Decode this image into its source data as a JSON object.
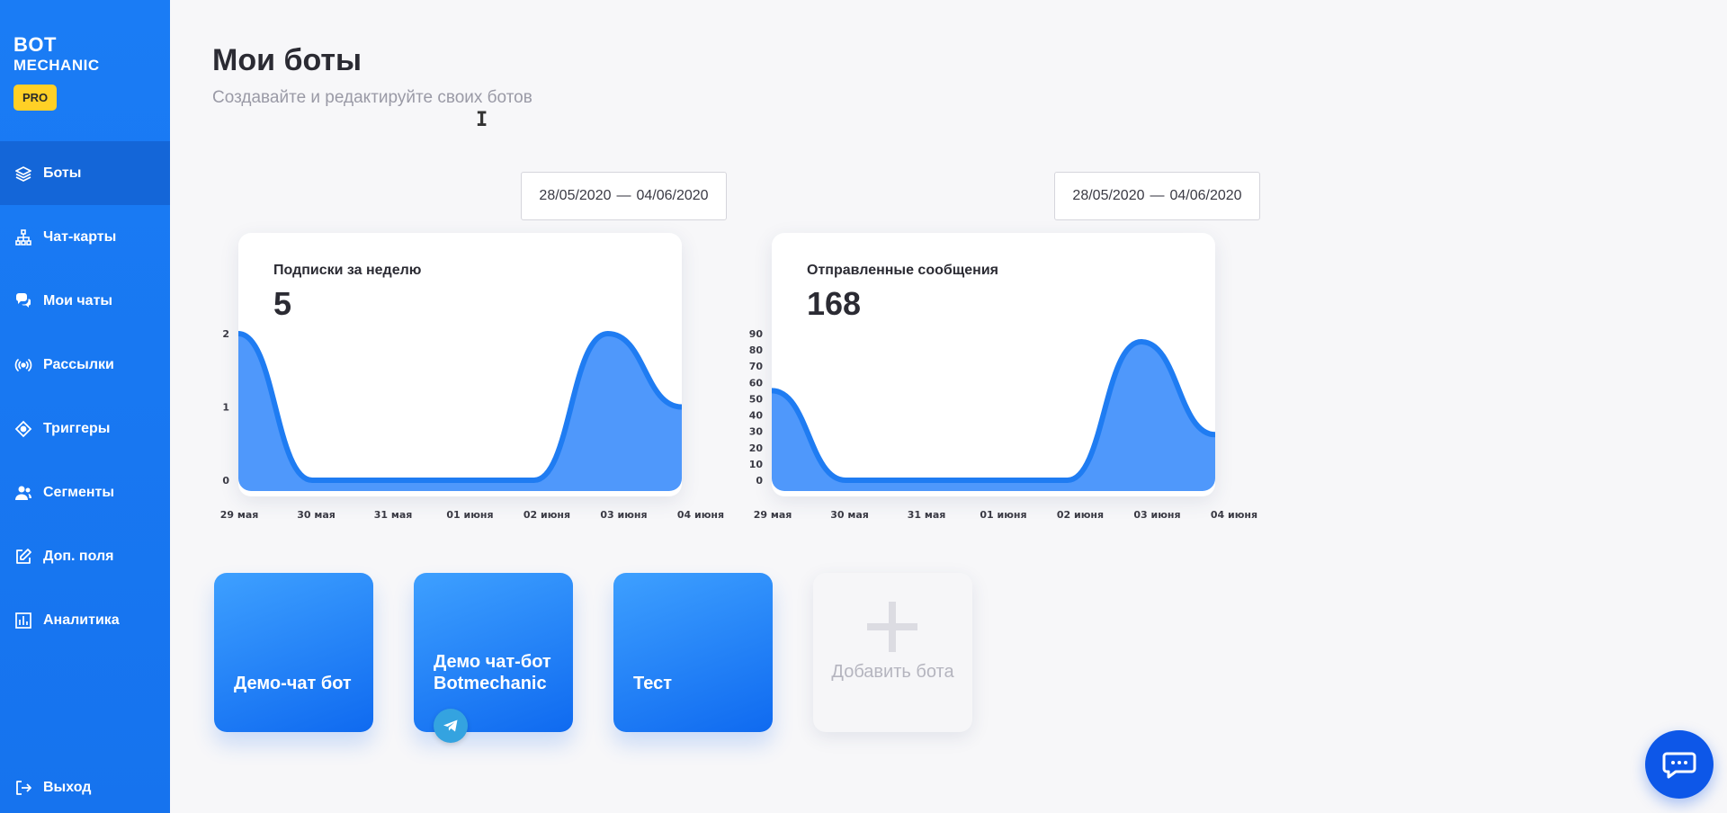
{
  "brand": {
    "title": "BOT",
    "subtitle": "MECHANIC",
    "badge": "PRO"
  },
  "sidebar": {
    "items": [
      {
        "label": "Боты",
        "icon": "layers-icon",
        "active": true
      },
      {
        "label": "Чат-карты",
        "icon": "sitemap-icon",
        "active": false
      },
      {
        "label": "Мои чаты",
        "icon": "chat-bubbles-icon",
        "active": false
      },
      {
        "label": "Рассылки",
        "icon": "broadcast-icon",
        "active": false
      },
      {
        "label": "Триггеры",
        "icon": "target-icon",
        "active": false
      },
      {
        "label": "Сегменты",
        "icon": "users-icon",
        "active": false
      },
      {
        "label": "Доп. поля",
        "icon": "edit-icon",
        "active": false
      },
      {
        "label": "Аналитика",
        "icon": "analytics-icon",
        "active": false
      }
    ],
    "logout": "Выход"
  },
  "header": {
    "title": "Мои боты",
    "subtitle": "Создавайте и редактируйте своих ботов"
  },
  "date_ranges": [
    {
      "from": "28/05/2020",
      "sep": "—",
      "to": "04/06/2020"
    },
    {
      "from": "28/05/2020",
      "sep": "—",
      "to": "04/06/2020"
    }
  ],
  "chart_data": [
    {
      "type": "area",
      "title": "Подписки за неделю",
      "total": "5",
      "categories": [
        "29 мая",
        "30 мая",
        "31 мая",
        "01 июня",
        "02 июня",
        "03 июня",
        "04 июня"
      ],
      "values": [
        2,
        0,
        0,
        0,
        0,
        2,
        1
      ],
      "yticks": [
        0,
        1,
        2
      ],
      "ylim": [
        0,
        2
      ],
      "color": "#1f7cf2"
    },
    {
      "type": "area",
      "title": "Отправленные сообщения",
      "total": "168",
      "categories": [
        "29 мая",
        "30 мая",
        "31 мая",
        "01 июня",
        "02 июня",
        "03 июня",
        "04 июня"
      ],
      "values": [
        55,
        0,
        0,
        0,
        0,
        85,
        28
      ],
      "yticks": [
        0,
        10,
        20,
        30,
        40,
        50,
        60,
        70,
        80,
        90
      ],
      "ylim": [
        0,
        90
      ],
      "color": "#1f7cf2"
    }
  ],
  "bots": [
    {
      "name": "Демо-чат бот",
      "telegram": false
    },
    {
      "name": "Демо чат-бот Botmechanic",
      "telegram": true
    },
    {
      "name": "Тест",
      "telegram": false
    }
  ],
  "add_bot": {
    "label": "Добавить бота"
  },
  "chat_widget": {
    "icon": "chat-icon"
  }
}
